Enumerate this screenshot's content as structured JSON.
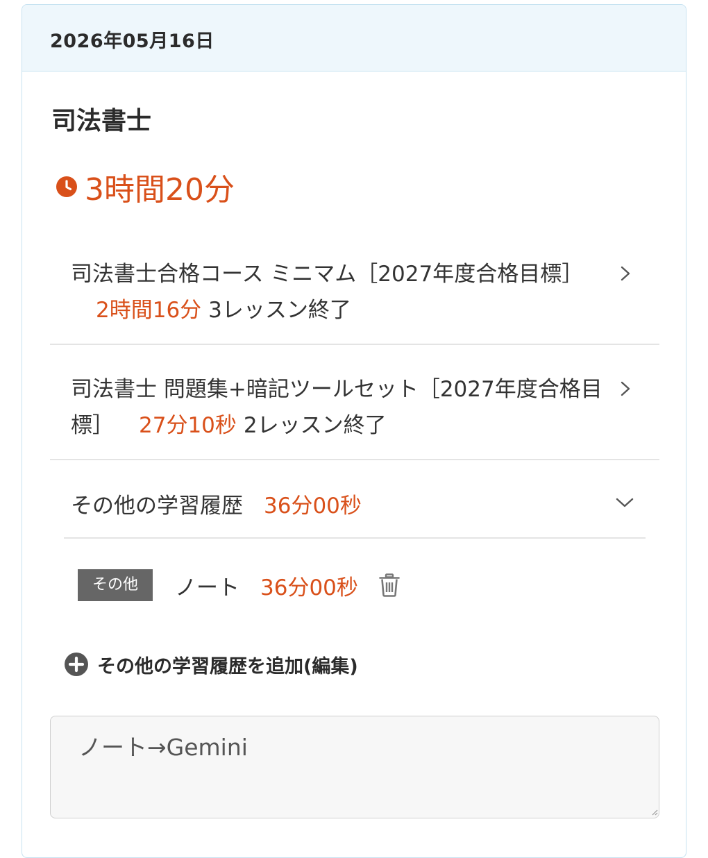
{
  "header": {
    "date": "2026年05月16日"
  },
  "subject": {
    "title": "司法書士",
    "total_time": "3時間20分"
  },
  "entries": [
    {
      "name": "司法書士合格コース ミニマム［2027年度合格目標］",
      "time": "2時間16分",
      "status": "3レッスン終了"
    },
    {
      "name": "司法書士 問題集+暗記ツールセット［2027年度合格目標］",
      "time": "27分10秒",
      "status": "2レッスン終了"
    }
  ],
  "other_history": {
    "label": "その他の学習履歴",
    "time": "36分00秒",
    "items": [
      {
        "tag": "その他",
        "label": "ノート",
        "time": "36分00秒"
      }
    ]
  },
  "add_link": {
    "label": "その他の学習履歴を追加(編集)"
  },
  "memo": {
    "value": "ノート→Gemini"
  },
  "colors": {
    "accent": "#d9501a",
    "header_bg": "#eef7fc",
    "border": "#c6e2f1",
    "tag_bg": "#666666"
  },
  "icons": {
    "clock": "clock-icon",
    "chevron_right": "chevron-right-icon",
    "chevron_down": "chevron-down-icon",
    "trash": "trash-icon",
    "plus": "plus-circle-icon"
  }
}
